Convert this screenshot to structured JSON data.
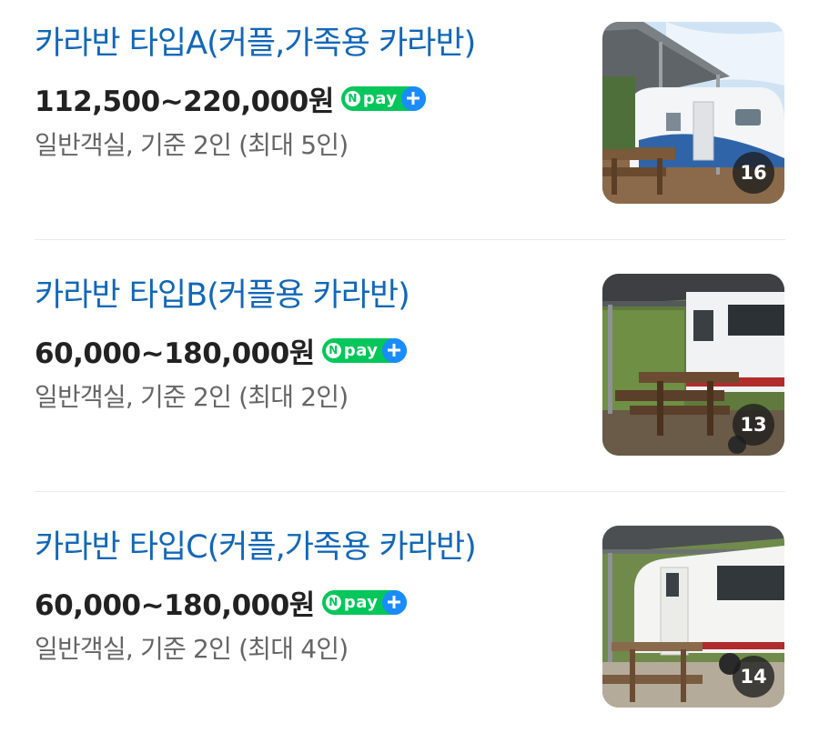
{
  "listings": [
    {
      "title": "카라반 타입A(커플,가족용 카라반)",
      "price": "112,500~220,000원",
      "meta": "일반객실, 기준 2인 (최대 5인)",
      "photo_count": "16",
      "npay_label": "pay"
    },
    {
      "title": "카라반 타입B(커플용 카라반)",
      "price": "60,000~180,000원",
      "meta": "일반객실, 기준 2인 (최대 2인)",
      "photo_count": "13",
      "npay_label": "pay"
    },
    {
      "title": "카라반 타입C(커플,가족용 카라반)",
      "price": "60,000~180,000원",
      "meta": "일반객실, 기준 2인 (최대 4인)",
      "photo_count": "14",
      "npay_label": "pay"
    }
  ],
  "colors": {
    "title": "#1267b9",
    "npay_green": "#03c75a",
    "npay_plus_blue": "#1a8cff"
  },
  "icons": {
    "npay_badge": "naver-pay-icon",
    "plus": "plus-icon"
  }
}
